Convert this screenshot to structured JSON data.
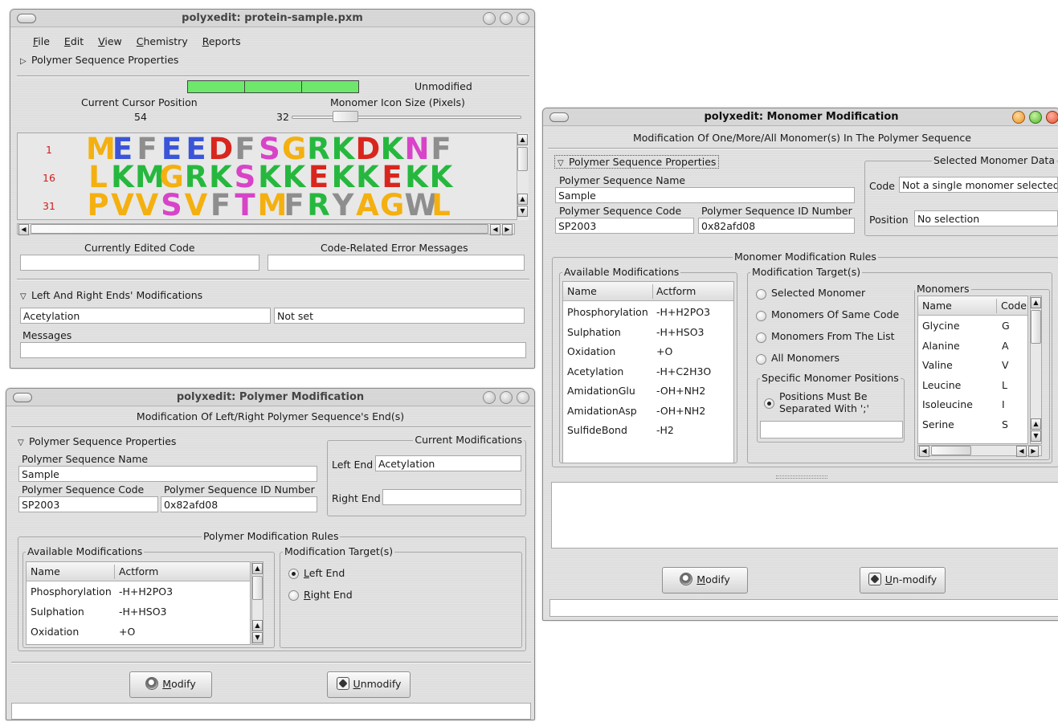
{
  "colors": {
    "seq_orange": "#f4b010",
    "seq_blue": "#3b55d8",
    "seq_grey": "#8e8e8e",
    "seq_green": "#26b83e",
    "seq_red": "#d8261e",
    "seq_magenta": "#d844c8",
    "seq_orange_dark": "#e87a18",
    "status_green": "#6ee86b",
    "position_red": "#d41a1a"
  },
  "main": {
    "title": "polyxedit: protein-sample.pxm",
    "menu": [
      {
        "label": "File",
        "u": "F",
        "rest": "ile"
      },
      {
        "label": "Edit",
        "u": "E",
        "rest": "dit"
      },
      {
        "label": "View",
        "u": "V",
        "rest": "iew"
      },
      {
        "label": "Chemistry",
        "u": "C",
        "rest": "hemistry"
      },
      {
        "label": "Reports",
        "u": "R",
        "rest": "eports"
      }
    ],
    "section_props": "Polymer Sequence Properties",
    "status": "Unmodified",
    "cursor_label": "Current Cursor Position",
    "cursor_value": "54",
    "icon_size_label": "Monomer Icon Size (Pixels)",
    "icon_size_value": "32",
    "icon_size_level": 0.2,
    "seq_rows": [
      {
        "num": "1",
        "letters": "MEFEEDFSGRKDKNF",
        "colors": [
          "o",
          "b",
          "g",
          "b",
          "b",
          "r",
          "g",
          "m",
          "o",
          "G",
          "G",
          "r",
          "G",
          "m",
          "g"
        ]
      },
      {
        "num": "16",
        "letters": "LKMGRKSKKEKKEKK",
        "colors": [
          "o",
          "G",
          "G",
          "o",
          "G",
          "G",
          "m",
          "G",
          "G",
          "r",
          "G",
          "G",
          "r",
          "G",
          "G"
        ]
      },
      {
        "num": "31",
        "letters": "PVVSVFTMFRYAGWL",
        "colors": [
          "o",
          "o",
          "o",
          "m",
          "o",
          "g",
          "m",
          "o",
          "g",
          "G",
          "g",
          "o",
          "o",
          "g",
          "o"
        ]
      }
    ],
    "edited_code_label": "Currently Edited Code",
    "error_label": "Code-Related Error Messages",
    "ends_section": "Left And Right Ends' Modifications",
    "left_end_value": "Acetylation",
    "right_end_value": "Not set",
    "messages_label": "Messages"
  },
  "polymer_mod": {
    "title": "polyxedit: Polymer Modification",
    "subtitle": "Modification Of Left/Right Polymer Sequence's End(s)",
    "section_props": "Polymer Sequence Properties",
    "name_label": "Polymer Sequence Name",
    "name_value": "Sample",
    "code_label": "Polymer Sequence Code",
    "code_value": "SP2003",
    "id_label": "Polymer Sequence ID Number",
    "id_value": "0x82afd08",
    "current_mods_title": "Current Modifications",
    "left_end_label": "Left End",
    "left_end_value": "Acetylation",
    "right_end_label": "Right End",
    "right_end_value": "",
    "rules_title": "Polymer Modification Rules",
    "available_title": "Available Modifications",
    "col_name": "Name",
    "col_actform": "Actform",
    "mods": [
      {
        "name": "Phosphorylation",
        "actform": "-H+H2PO3"
      },
      {
        "name": "Sulphation",
        "actform": "-H+HSO3"
      },
      {
        "name": "Oxidation",
        "actform": "+O"
      }
    ],
    "target_title": "Modification Target(s)",
    "targets": [
      {
        "u": "L",
        "rest": "eft End",
        "selected": true
      },
      {
        "u": "R",
        "rest": "ight End",
        "selected": false
      }
    ],
    "modify_u": "M",
    "modify_rest": "odify",
    "unmodify_u": "U",
    "unmodify_rest": "nmodify"
  },
  "monomer_mod": {
    "title": "polyxedit: Monomer Modification",
    "subtitle": "Modification Of One/More/All Monomer(s) In The Polymer Sequence",
    "section_props": "Polymer Sequence Properties",
    "name_label": "Polymer Sequence Name",
    "name_value": "Sample",
    "code_label": "Polymer Sequence Code",
    "code_value": "SP2003",
    "id_label": "Polymer Sequence ID Number",
    "id_value": "0x82afd08",
    "selected_title": "Selected Monomer Data",
    "sel_code_label": "Code",
    "sel_code_value": "Not a single monomer selected",
    "sel_pos_label": "Position",
    "sel_pos_value": "No selection",
    "rules_title": "Monomer Modification Rules",
    "available_title": "Available Modifications",
    "col_name": "Name",
    "col_actform": "Actform",
    "mods": [
      {
        "name": "Phosphorylation",
        "actform": "-H+H2PO3"
      },
      {
        "name": "Sulphation",
        "actform": "-H+HSO3"
      },
      {
        "name": "Oxidation",
        "actform": "+O"
      },
      {
        "name": "Acetylation",
        "actform": "-H+C2H3O"
      },
      {
        "name": "AmidationGlu",
        "actform": "-OH+NH2"
      },
      {
        "name": "AmidationAsp",
        "actform": "-OH+NH2"
      },
      {
        "name": "SulfideBond",
        "actform": "-H2"
      }
    ],
    "target_title": "Modification Target(s)",
    "targets": [
      "Selected Monomer",
      "Monomers Of Same Code",
      "Monomers From The List",
      "All Monomers"
    ],
    "positions_title": "Specific Monomer Positions",
    "positions_line1": "Positions Must Be",
    "positions_line2": "Separated With ';'",
    "monomers_title": "Monomers",
    "mon_col_name": "Name",
    "mon_col_code": "Code",
    "monomers": [
      {
        "name": "Glycine",
        "code": "G"
      },
      {
        "name": "Alanine",
        "code": "A"
      },
      {
        "name": "Valine",
        "code": "V"
      },
      {
        "name": "Leucine",
        "code": "L"
      },
      {
        "name": "Isoleucine",
        "code": "I"
      },
      {
        "name": "Serine",
        "code": "S"
      }
    ],
    "modify_u": "M",
    "modify_rest": "odify",
    "unmodify_pre": "",
    "unmodify_u": "U",
    "unmodify_rest": "n-modify"
  }
}
